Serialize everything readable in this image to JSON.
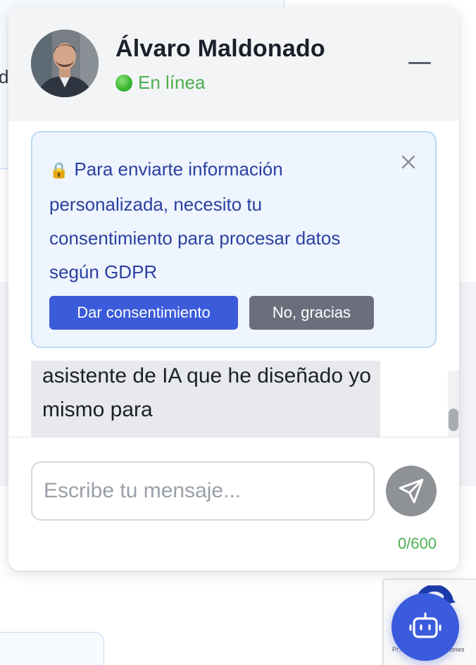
{
  "header": {
    "agent_name": "Álvaro Maldonado",
    "status_text": "En línea",
    "avatar_icon": "avatar-photo",
    "minimize_icon": "minimize-icon"
  },
  "gdpr": {
    "lock_icon": "lock-icon",
    "message": "Para enviarte información personalizada, necesito tu consentimiento para procesar datos según GDPR",
    "close_icon": "close-icon",
    "consent_button": "Dar consentimiento",
    "decline_button": "No, gracias"
  },
  "messages": [
    {
      "sender": "agent",
      "text": "asistente de IA que he diseñado yo mismo para"
    }
  ],
  "input": {
    "placeholder": "Escribe tu mensaje...",
    "value": "",
    "char_count": "0/600",
    "send_icon": "send-icon"
  },
  "launcher": {
    "icon": "robot-icon"
  },
  "background": {
    "partial_letter": "d",
    "recaptcha_text": "Pr...acidad - Condiciones"
  },
  "colors": {
    "accent": "#3b5bdb",
    "online": "#4caf50",
    "gdpr_text": "#2b3fa0",
    "gdpr_bg": "#eef5fe",
    "decline_bg": "#6b6f7d"
  }
}
